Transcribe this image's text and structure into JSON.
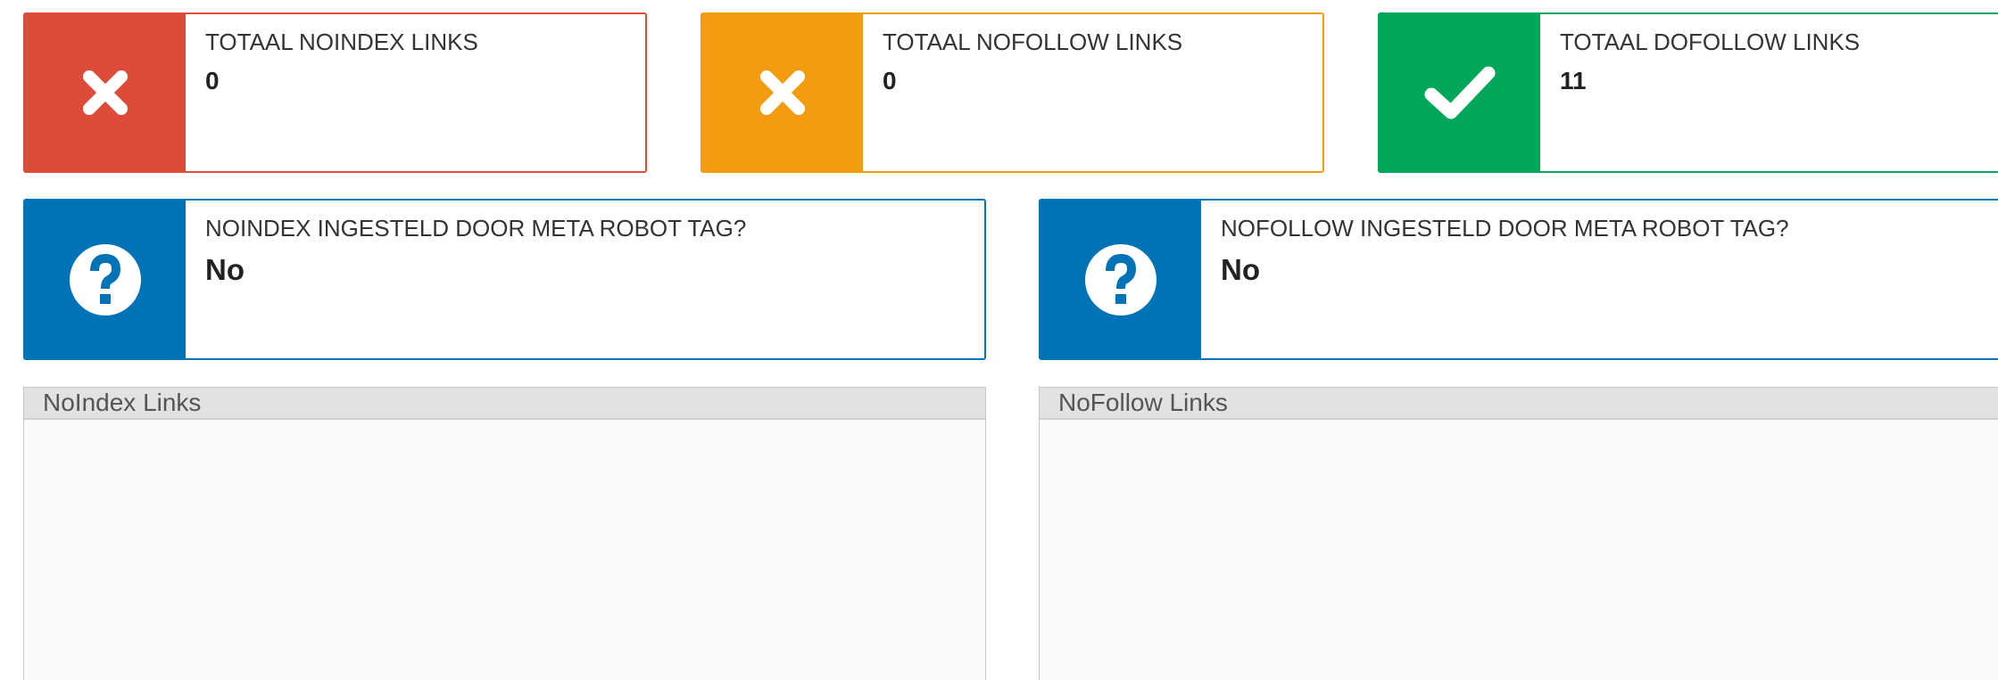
{
  "stats": {
    "noindex": {
      "label": "TOTAAL NOINDEX LINKS",
      "value": "0",
      "icon": "x-icon",
      "color": "#dd4b39"
    },
    "nofollow": {
      "label": "TOTAAL NOFOLLOW LINKS",
      "value": "0",
      "icon": "x-icon",
      "color": "#f39c12"
    },
    "dofollow": {
      "label": "TOTAAL DOFOLLOW LINKS",
      "value": "11",
      "icon": "check-icon",
      "color": "#00a65a"
    }
  },
  "meta": {
    "noindex": {
      "label": "NOINDEX INGESTELD DOOR META ROBOT TAG?",
      "value": "No",
      "icon": "question-circle-icon",
      "color": "#0073b7"
    },
    "nofollow": {
      "label": "NOFOLLOW INGESTELD DOOR META ROBOT TAG?",
      "value": "No",
      "icon": "question-circle-icon",
      "color": "#0073b7"
    }
  },
  "panels": {
    "noindex": {
      "title": "NoIndex Links"
    },
    "nofollow": {
      "title": "NoFollow Links"
    }
  }
}
